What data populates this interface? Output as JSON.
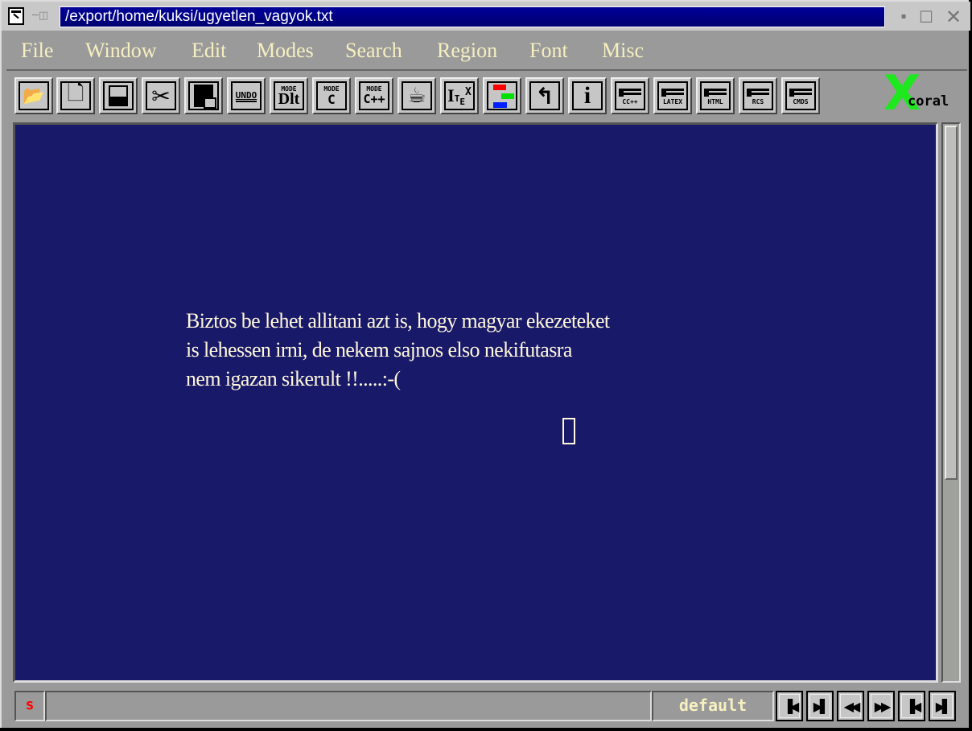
{
  "window": {
    "title": "/export/home/kuksi/ugyetlen_vagyok.txt",
    "icons": {
      "app": "xcoral-app-icon",
      "pin": "pin-icon"
    },
    "controls": {
      "minimize": "▪",
      "maximize": "☐",
      "close": "✕"
    }
  },
  "menubar": {
    "items": [
      "File",
      "Window",
      "Edit",
      "Modes",
      "Search",
      "Region",
      "Font",
      "Misc"
    ]
  },
  "toolbar": {
    "tools": [
      {
        "name": "open-file",
        "glyph": "📂"
      },
      {
        "name": "new-file",
        "glyph": "🗋"
      },
      {
        "name": "save-file",
        "glyph": "💾"
      },
      {
        "name": "cut",
        "glyph": "✂"
      },
      {
        "name": "paste",
        "glyph": "📋"
      },
      {
        "name": "undo",
        "label": "UNDO"
      },
      {
        "name": "mode-dlt",
        "top": "MODE",
        "big": "Dlt"
      },
      {
        "name": "mode-c",
        "top": "MODE",
        "big": "C"
      },
      {
        "name": "mode-cpp",
        "top": "MODE",
        "big": "C++"
      },
      {
        "name": "java",
        "glyph": "☕"
      },
      {
        "name": "latex",
        "label": "LTEX"
      },
      {
        "name": "colors",
        "colors": [
          "#ff0000",
          "#00e000",
          "#0020ff"
        ]
      },
      {
        "name": "go-back",
        "glyph": "↰"
      },
      {
        "name": "info",
        "glyph": "i"
      },
      {
        "name": "make-cc",
        "label": "CC++"
      },
      {
        "name": "make-latex",
        "label": "LATEX"
      },
      {
        "name": "make-html",
        "label": "HTML"
      },
      {
        "name": "make-rcs",
        "label": "RCS"
      },
      {
        "name": "make-cmds",
        "label": "CMDS"
      }
    ],
    "logo": {
      "x": "X",
      "text": "coral",
      "color": "#1ee81e"
    }
  },
  "editor": {
    "background": "#19196a",
    "text_color": "#fff8dc",
    "lines": [
      "Biztos be lehet allitani azt is, hogy magyar ekezeteket",
      "is lehessen irni, de nekem sajnos elso nekifutasra",
      "nem igazan sikerult !!.....:-("
    ]
  },
  "statusbar": {
    "modified_flag": "s",
    "message": "",
    "mode": "default",
    "nav_buttons": [
      {
        "name": "first-window",
        "glyph": "▐◀"
      },
      {
        "name": "next-window",
        "glyph": "▶▌"
      },
      {
        "name": "rewind",
        "glyph": "◀◀"
      },
      {
        "name": "fast-forward",
        "glyph": "▶▶"
      },
      {
        "name": "previous",
        "glyph": "▐◀"
      },
      {
        "name": "next",
        "glyph": "▶▌"
      }
    ]
  }
}
